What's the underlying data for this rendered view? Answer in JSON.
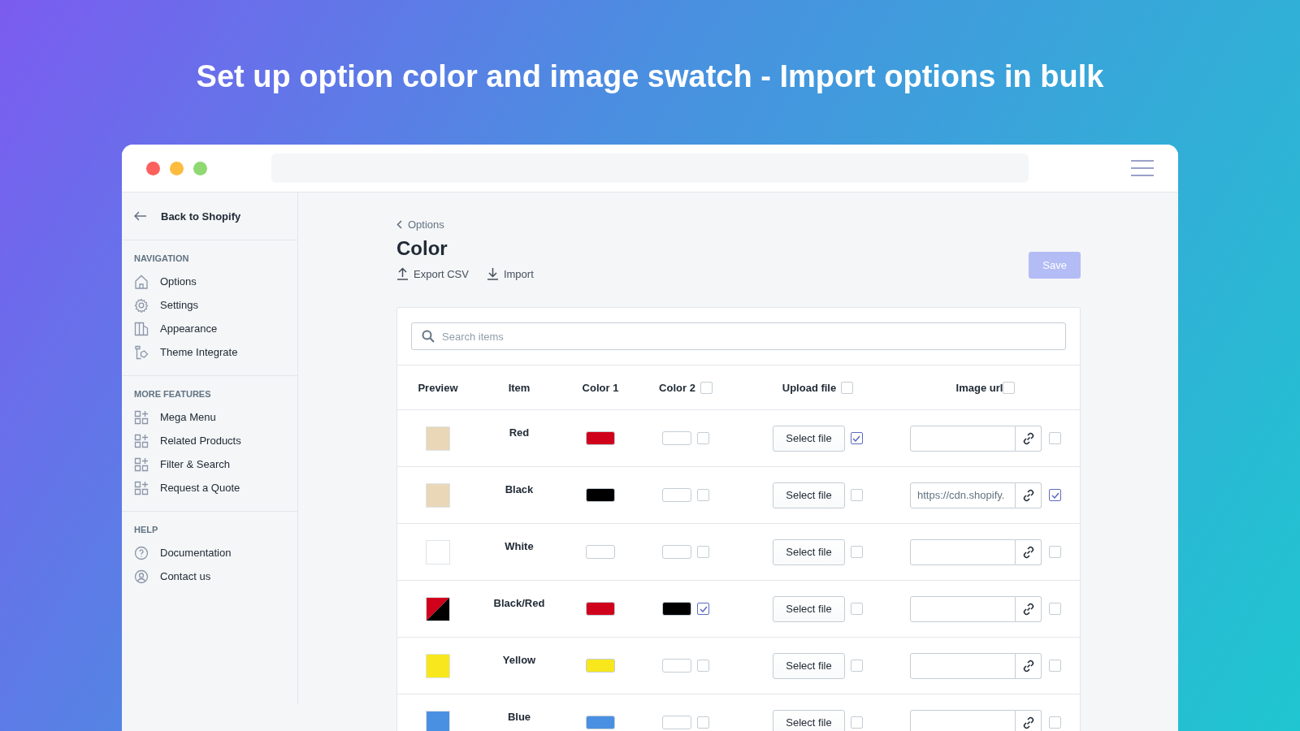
{
  "headline": "Set up option color and image swatch - Import options in bulk",
  "sidebar": {
    "back": "Back to Shopify",
    "sections": [
      {
        "title": "NAVIGATION",
        "items": [
          "Options",
          "Settings",
          "Appearance",
          "Theme Integrate"
        ]
      },
      {
        "title": "MORE FEATURES",
        "items": [
          "Mega Menu",
          "Related Products",
          "Filter & Search",
          "Request a Quote"
        ]
      },
      {
        "title": "HELP",
        "items": [
          "Documentation",
          "Contact us"
        ]
      }
    ]
  },
  "breadcrumb": "Options",
  "page_title": "Color",
  "actions": [
    "Export CSV",
    "Import"
  ],
  "save_button": {
    "label": "Save",
    "disabled": true
  },
  "search": {
    "placeholder": "Search items"
  },
  "columns": [
    {
      "label": "Preview"
    },
    {
      "label": "Item"
    },
    {
      "label": "Color 1"
    },
    {
      "label": "Color 2",
      "checked": false
    },
    {
      "label": "Upload file",
      "checked": false
    },
    {
      "label": "Image url",
      "checked": false
    }
  ],
  "rows": [
    {
      "preview": {
        "kind": "photo"
      },
      "item": "Red",
      "color1": {
        "color": "#d0021b"
      },
      "color2": {
        "checked": false
      },
      "upload": "Select file",
      "upload_checked": true,
      "image_url": "",
      "url_checked": false
    },
    {
      "preview": {
        "kind": "photo"
      },
      "item": "Black",
      "color1": {
        "color": "#000000"
      },
      "color2": {
        "checked": false
      },
      "upload": "Select file",
      "upload_checked": false,
      "image_url": "https://cdn.shopify.",
      "url_checked": true
    },
    {
      "preview": {
        "kind": "swatch",
        "color": "#ffffff"
      },
      "item": "White",
      "color1": {
        "color": "#ffffff"
      },
      "color2": {
        "checked": false
      },
      "upload": "Select file",
      "upload_checked": false,
      "image_url": "",
      "url_checked": false
    },
    {
      "preview": {
        "kind": "split",
        "parts": [
          {
            "color": "#d0021b"
          },
          {
            "color": "#000000"
          }
        ]
      },
      "item": "Black/Red",
      "color1": {
        "color": "#d0021b"
      },
      "color2": {
        "color": "#000000",
        "checked": true
      },
      "upload": "Select file",
      "upload_checked": false,
      "image_url": "",
      "url_checked": false
    },
    {
      "preview": {
        "kind": "swatch",
        "color": "#f8e71c"
      },
      "item": "Yellow",
      "color1": {
        "color": "#f8e71c"
      },
      "color2": {
        "checked": false
      },
      "upload": "Select file",
      "upload_checked": false,
      "image_url": "",
      "url_checked": false
    },
    {
      "preview": {
        "kind": "swatch",
        "color": "#4a90e2"
      },
      "item": "Blue",
      "color1": {
        "color": "#4a90e2"
      },
      "color2": {
        "checked": false
      },
      "upload": "Select file",
      "upload_checked": false,
      "image_url": "",
      "url_checked": false
    }
  ]
}
